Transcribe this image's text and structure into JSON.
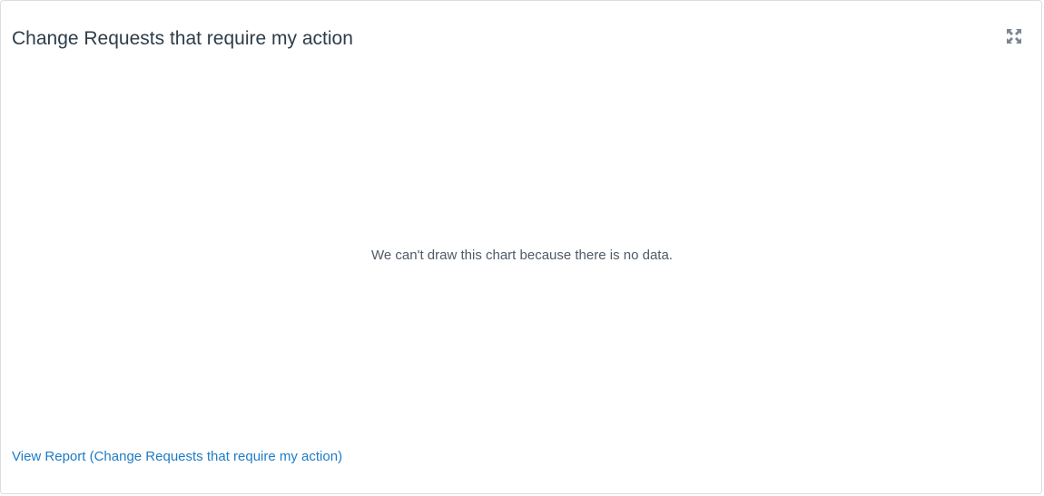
{
  "widget": {
    "title": "Change Requests that require my action",
    "expand_icon": "expand-icon",
    "empty_message": "We can't draw this chart because there is no data.",
    "report_link": "View Report (Change Requests that require my action)",
    "colors": {
      "title": "#2e3d49",
      "message": "#4f5b66",
      "link": "#1f7cc4",
      "border": "#d9dde2"
    }
  }
}
